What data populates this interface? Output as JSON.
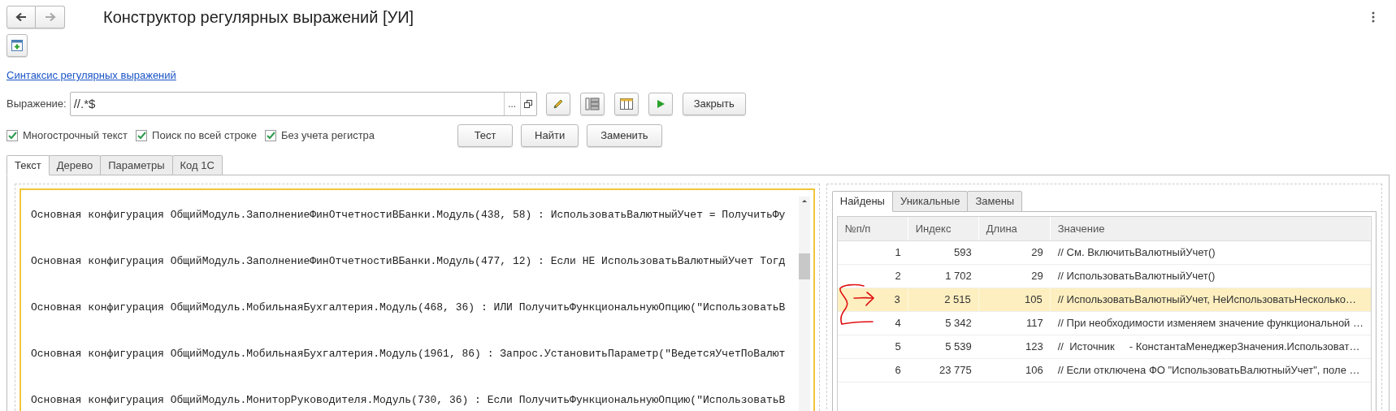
{
  "title": "Конструктор регулярных выражений [УИ]",
  "link": "Синтаксис регулярных выражений",
  "expression": {
    "label": "Выражение:",
    "value": "//.*$",
    "choice_button": "..."
  },
  "close_button": "Закрыть",
  "options": [
    {
      "label": "Многострочный текст",
      "checked": true
    },
    {
      "label": "Поиск по всей строке",
      "checked": true
    },
    {
      "label": "Без учета регистра",
      "checked": true
    }
  ],
  "run_buttons": [
    "Тест",
    "Найти",
    "Заменить"
  ],
  "tabs": [
    {
      "label": "Текст",
      "selected": true
    },
    {
      "label": "Дерево",
      "selected": false
    },
    {
      "label": "Параметры",
      "selected": false
    },
    {
      "label": "Код 1С",
      "selected": false
    }
  ],
  "editor": {
    "lines": [
      "Основная конфигурация ОбщийМодуль.ЗаполнениеФинОтчетностиВБанки.Модуль(438, 58) : ИспользоватьВалютныйУчет = ПолучитьФу",
      "Основная конфигурация ОбщийМодуль.ЗаполнениеФинОтчетностиВБанки.Модуль(477, 12) : Если НЕ ИспользоватьВалютныйУчет Тогд",
      "Основная конфигурация ОбщийМодуль.МобильнаяБухгалтерия.Модуль(468, 36) : ИЛИ ПолучитьФункциональнуюОпцию(\"ИспользоватьВ",
      "Основная конфигурация ОбщийМодуль.МобильнаяБухгалтерия.Модуль(1961, 86) : Запрос.УстановитьПараметр(\"ВедетсяУчетПоВалют",
      "Основная конфигурация ОбщийМодуль.МониторРуководителя.Модуль(730, 36) : Если ПолучитьФункциональнуюОпцию(\"ИспользоватьВ"
    ]
  },
  "results": {
    "tabs": [
      {
        "label": "Найдены",
        "selected": true
      },
      {
        "label": "Уникальные",
        "selected": false
      },
      {
        "label": "Замены",
        "selected": false
      }
    ],
    "columns": [
      "№п/п",
      "Индекс",
      "Длина",
      "Значение"
    ],
    "rows": [
      {
        "cells": [
          "1",
          "593",
          "29",
          "// См. ВключитьВалютныйУчет()"
        ],
        "selected": false
      },
      {
        "cells": [
          "2",
          "1 702",
          "29",
          "// ИспользоватьВалютныйУчет()"
        ],
        "selected": false
      },
      {
        "cells": [
          "3",
          "2 515",
          "105",
          "// ИспользоватьВалютныйУчет, НеИспользоватьНесколько…"
        ],
        "selected": true
      },
      {
        "cells": [
          "4",
          "5 342",
          "117",
          "// При необходимости изменяем значение функциональной …"
        ],
        "selected": false
      },
      {
        "cells": [
          "5",
          "5 539",
          "123",
          "//  Источник     - КонстантаМенеджерЗначения.Использоват…"
        ],
        "selected": false
      },
      {
        "cells": [
          "6",
          "23 775",
          "106",
          "// Если отключена ФО \"ИспользоватьВалютныйУчет\", поле …"
        ],
        "selected": false
      }
    ]
  }
}
